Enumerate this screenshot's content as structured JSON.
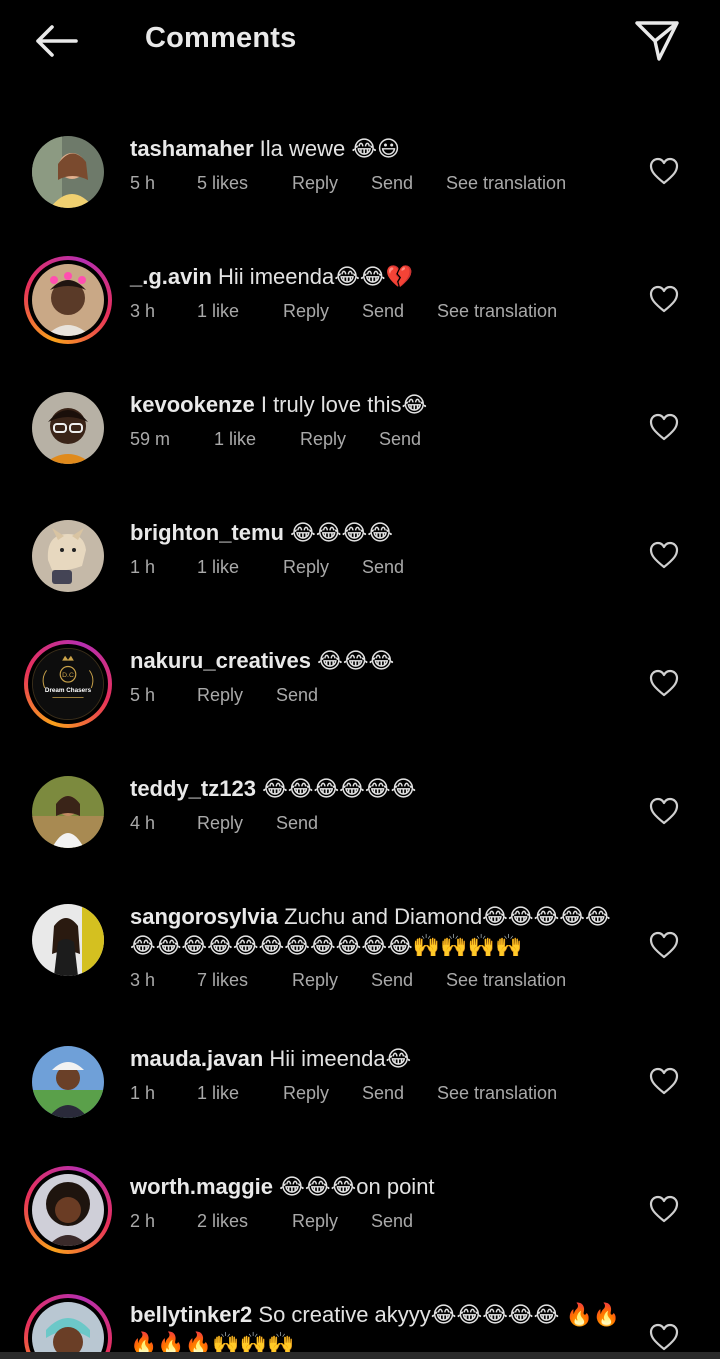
{
  "header": {
    "title": "Comments",
    "back_icon": "arrow-left-icon",
    "share_icon": "paper-plane-icon"
  },
  "comments": [
    {
      "username": "tashamaher",
      "text": " Ila wewe 😂😃",
      "time": "5 h",
      "likes": "5 likes",
      "reply": "Reply",
      "send": "Send",
      "translate": "See translation"
    },
    {
      "username": "_.g.avin",
      "text": " Hii imeenda😂😂💔",
      "time": "3 h",
      "likes": "1 like",
      "reply": "Reply",
      "send": "Send",
      "translate": "See translation"
    },
    {
      "username": "kevookenze",
      "text": " I truly love this😂",
      "time": "59 m",
      "likes": "1 like",
      "reply": "Reply",
      "send": "Send"
    },
    {
      "username": "brighton_temu",
      "text": " 😂😂😂😂",
      "time": "1 h",
      "likes": "1 like",
      "reply": "Reply",
      "send": "Send"
    },
    {
      "username": "nakuru_creatives",
      "text": " 😂😂😂",
      "time": "5 h",
      "reply": "Reply",
      "send": "Send"
    },
    {
      "username": "teddy_tz123",
      "text": " 😂😂😂😂😂😂",
      "time": "4 h",
      "reply": "Reply",
      "send": "Send"
    },
    {
      "username": "sangorosylvia",
      "text": " Zuchu and Diamond😂😂😂😂😂😂😂😂😂😂😂😂😂😂😂😂🙌🙌🙌🙌",
      "time": "3 h",
      "likes": "7 likes",
      "reply": "Reply",
      "send": "Send",
      "translate": "See translation"
    },
    {
      "username": "mauda.javan",
      "text": " Hii imeenda😂",
      "time": "1 h",
      "likes": "1 like",
      "reply": "Reply",
      "send": "Send",
      "translate": "See translation"
    },
    {
      "username": "worth.maggie",
      "text": " 😂😂😂on point",
      "time": "2 h",
      "likes": "2 likes",
      "reply": "Reply",
      "send": "Send"
    },
    {
      "username": "bellytinker2",
      "text": " So creative akyyy😂😂😂😂😂 🔥🔥🔥🔥🔥🙌🙌🙌"
    }
  ],
  "avatar_badge": {
    "line1": "D.C",
    "line2": "Dream Chasers"
  },
  "colors": {
    "background": "#000000",
    "text": "#e2e2e2",
    "meta": "#a9a9a9",
    "ring_start": "#f9a11b",
    "ring_mid": "#e7305b",
    "ring_end": "#b62fb0"
  }
}
